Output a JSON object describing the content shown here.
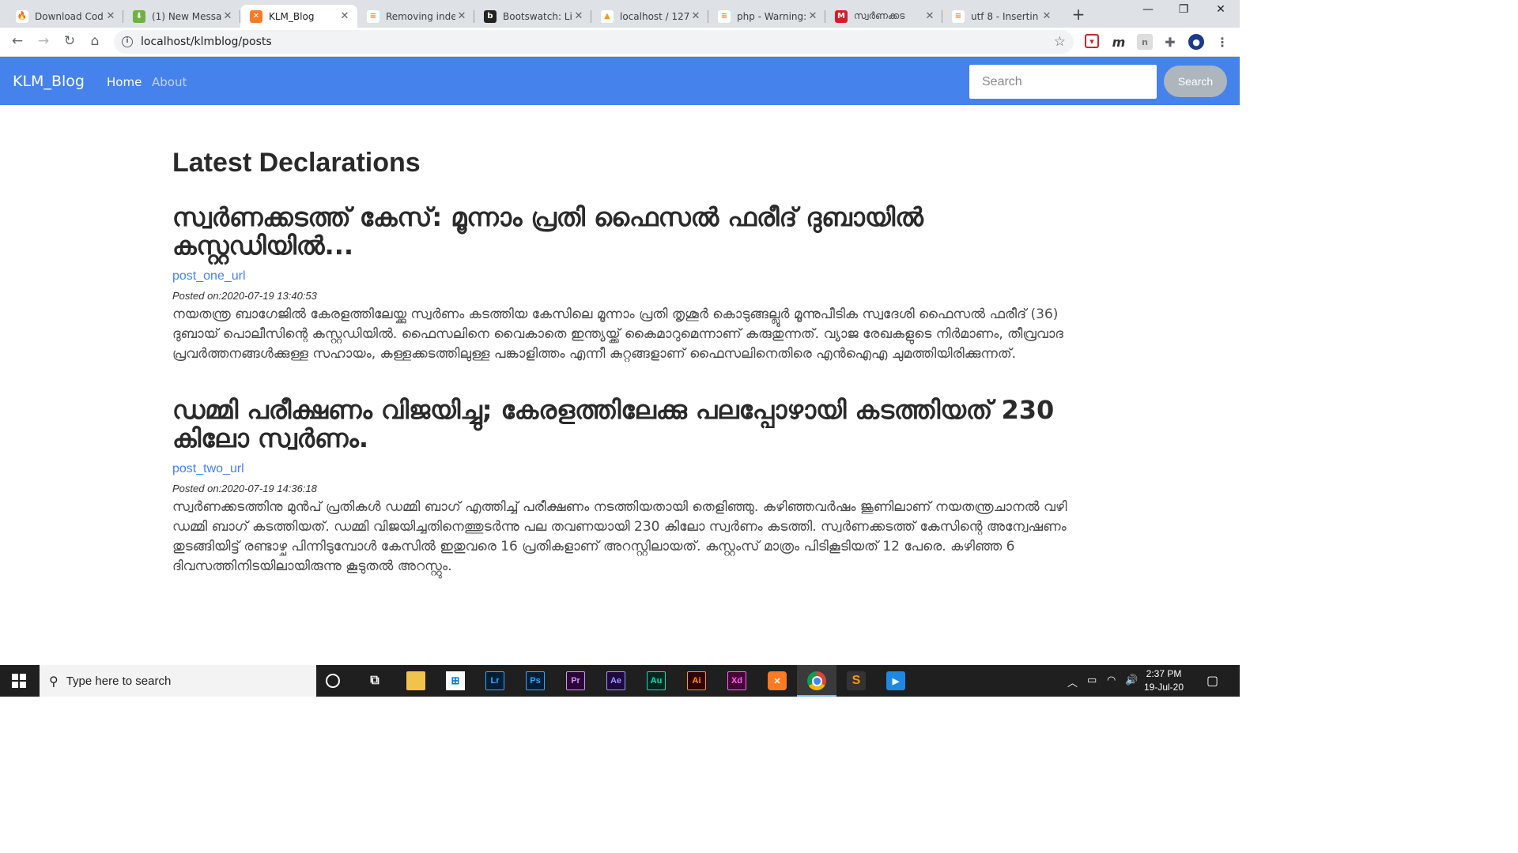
{
  "browser": {
    "tabs": [
      {
        "title": "Download Cod",
        "icon": "codeigniter-flame-icon",
        "color": "#e8491d",
        "glyph": "🔥"
      },
      {
        "title": "(1) New Messa",
        "icon": "green-arrow-icon",
        "color": "#6db33f",
        "glyph": "⬇"
      },
      {
        "title": "KLM_Blog",
        "icon": "xampp-icon",
        "color": "#fb7a24",
        "glyph": "✕",
        "active": true
      },
      {
        "title": "Removing inde",
        "icon": "stackoverflow-icon",
        "color": "#f48024",
        "glyph": "≡"
      },
      {
        "title": "Bootswatch: Lit",
        "icon": "bootswatch-icon",
        "color": "#222222",
        "glyph": "b"
      },
      {
        "title": "localhost / 127",
        "icon": "phpmyadmin-icon",
        "color": "#f89c0e",
        "glyph": "▲"
      },
      {
        "title": "php - Warning:",
        "icon": "stackoverflow-icon",
        "color": "#f48024",
        "glyph": "≡"
      },
      {
        "title": "സ്വർണക്കട",
        "icon": "news-site-icon",
        "color": "#d11f26",
        "glyph": "M"
      },
      {
        "title": "utf 8 - Insertin",
        "icon": "stackoverflow-icon",
        "color": "#f48024",
        "glyph": "≡"
      }
    ],
    "new_tab": "+",
    "window_controls": {
      "minimize": "—",
      "maximize": "❐",
      "close": "✕"
    },
    "url": "localhost/klmblog/posts"
  },
  "navbar": {
    "brand": "KLM_Blog",
    "links": [
      "Home",
      "About"
    ],
    "search_placeholder": "Search",
    "search_button": "Search",
    "bg_color": "#4582ec"
  },
  "page": {
    "heading": "Latest Declarations",
    "posts": [
      {
        "title": "സ്വർണക്കടത്ത് കേസ്: മൂന്നാം പ്രതി ഫൈസൽ ഫരീദ് ദുബായിൽ കസ്റ്റഡിയിൽ...",
        "url_text": "post_one_url",
        "posted_on": "Posted on:2020-07-19 13:40:53",
        "body": "നയതന്ത്ര ബാഗേജിൽ കേരളത്തിലേയ്ക്കു സ്വർണം കടത്തിയ കേസിലെ മൂന്നാം പ്രതി തൃശൂർ കൊടുങ്ങല്ലൂർ മൂന്നുപീടിക സ്വദേശി ഫൈസൽ ഫരീദ് (36) ദുബായ് പൊലീസിന്റെ കസ്റ്റഡിയിൽ. ഫൈസലിനെ വൈകാതെ ഇന്ത്യയ്ക്ക് കൈമാറുമെന്നാണ് കരുതുന്നത്. വ്യാജ രേഖകളുടെ നിർമാണം, തീവ്രവാദ പ്രവർത്തനങ്ങൾക്കുള്ള സഹായം, കള്ളക്കടത്തിലുള്ള പങ്കാളിത്തം എന്നീ കുറ്റങ്ങളാണ് ഫൈസലിനെതിരെ എൻഐഎ ചുമത്തിയിരിക്കുന്നത്."
      },
      {
        "title": "ഡമ്മി പരീക്ഷണം വിജയിച്ചു; കേരളത്തിലേക്കു പലപ്പോഴായി കടത്തിയത് 230 കിലോ സ്വർണം.",
        "url_text": "post_two_url",
        "posted_on": "Posted on:2020-07-19 14:36:18",
        "body": "സ്വർണക്കടത്തിനു മുൻപ് പ്രതികൾ ഡമ്മി ബാഗ് എത്തിച്ച് പരീക്ഷണം നടത്തിയതായി തെളിഞ്ഞു. കഴിഞ്ഞവർഷം ജൂണിലാണ് നയതന്ത്രചാനൽ വഴി ഡമ്മി ബാഗ് കടത്തിയത്. ഡമ്മി വിജയിച്ചതിനെത്തുടർന്നു പല തവണയായി 230 കിലോ സ്വർണം കടത്തി. സ്വർണക്കടത്ത് കേസിന്റെ അന്വേഷണം തുടങ്ങിയിട്ട് രണ്ടാഴ്ച പിന്നിടുമ്പോൾ കേസിൽ ഇതുവരെ 16 പ്രതികളാണ് അറസ്റ്റിലായത്. കസ്റ്റംസ് മാത്രം പിടികൂടിയത് 12 പേരെ. കഴിഞ്ഞ 6 ദിവസത്തിനിടയിലായിരുന്നു കൂടുതൽ അറസ്റ്റും."
      }
    ]
  },
  "taskbar": {
    "search_text": "Type here to search",
    "apps": [
      {
        "label": "Lr",
        "name": "lightroom-icon",
        "bg": "#001e36",
        "fg": "#31a8ff"
      },
      {
        "label": "Ps",
        "name": "photoshop-icon",
        "bg": "#001e36",
        "fg": "#31a8ff"
      },
      {
        "label": "Pr",
        "name": "premiere-icon",
        "bg": "#2a0634",
        "fg": "#d291ff"
      },
      {
        "label": "Ae",
        "name": "after-effects-icon",
        "bg": "#1f0740",
        "fg": "#9999ff"
      },
      {
        "label": "Au",
        "name": "audition-icon",
        "bg": "#00261d",
        "fg": "#00e4bb"
      },
      {
        "label": "Ai",
        "name": "illustrator-icon",
        "bg": "#330000",
        "fg": "#ff9a00"
      },
      {
        "label": "Xd",
        "name": "xd-icon",
        "bg": "#470137",
        "fg": "#ff61f6"
      }
    ],
    "clock_time": "2:37 PM",
    "clock_date": "19-Jul-20"
  }
}
